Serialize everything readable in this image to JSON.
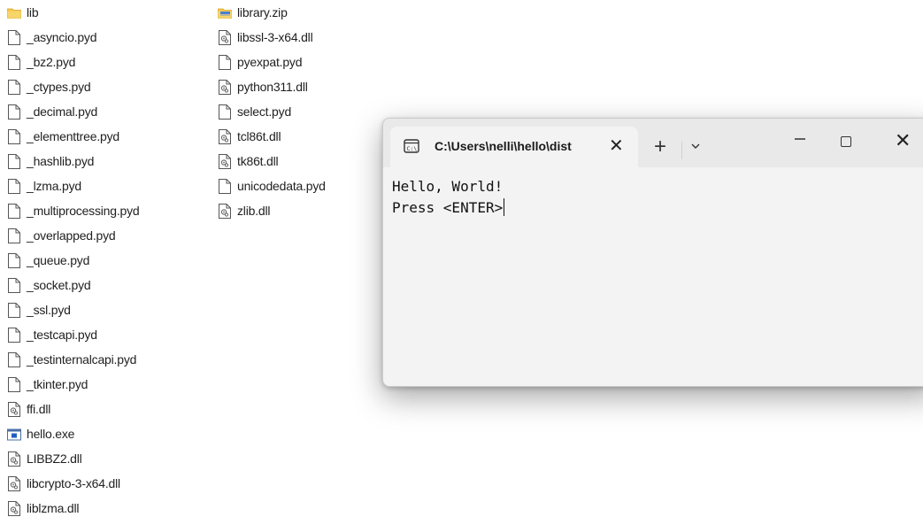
{
  "explorer": {
    "column1": [
      {
        "name": "lib",
        "icon": "folder-icon"
      },
      {
        "name": "_asyncio.pyd",
        "icon": "file-icon"
      },
      {
        "name": "_bz2.pyd",
        "icon": "file-icon"
      },
      {
        "name": "_ctypes.pyd",
        "icon": "file-icon"
      },
      {
        "name": "_decimal.pyd",
        "icon": "file-icon"
      },
      {
        "name": "_elementtree.pyd",
        "icon": "file-icon"
      },
      {
        "name": "_hashlib.pyd",
        "icon": "file-icon"
      },
      {
        "name": "_lzma.pyd",
        "icon": "file-icon"
      },
      {
        "name": "_multiprocessing.pyd",
        "icon": "file-icon"
      },
      {
        "name": "_overlapped.pyd",
        "icon": "file-icon"
      },
      {
        "name": "_queue.pyd",
        "icon": "file-icon"
      },
      {
        "name": "_socket.pyd",
        "icon": "file-icon"
      },
      {
        "name": "_ssl.pyd",
        "icon": "file-icon"
      },
      {
        "name": "_testcapi.pyd",
        "icon": "file-icon"
      },
      {
        "name": "_testinternalcapi.pyd",
        "icon": "file-icon"
      },
      {
        "name": "_tkinter.pyd",
        "icon": "file-icon"
      },
      {
        "name": "ffi.dll",
        "icon": "dll-icon"
      },
      {
        "name": "hello.exe",
        "icon": "exe-icon"
      },
      {
        "name": "LIBBZ2.dll",
        "icon": "dll-icon"
      },
      {
        "name": "libcrypto-3-x64.dll",
        "icon": "dll-icon"
      },
      {
        "name": "liblzma.dll",
        "icon": "dll-icon"
      }
    ],
    "column2": [
      {
        "name": "library.zip",
        "icon": "zip-folder-icon"
      },
      {
        "name": "libssl-3-x64.dll",
        "icon": "dll-icon"
      },
      {
        "name": "pyexpat.pyd",
        "icon": "file-icon"
      },
      {
        "name": "python311.dll",
        "icon": "dll-icon"
      },
      {
        "name": "select.pyd",
        "icon": "file-icon"
      },
      {
        "name": "tcl86t.dll",
        "icon": "dll-icon"
      },
      {
        "name": "tk86t.dll",
        "icon": "dll-icon"
      },
      {
        "name": "unicodedata.pyd",
        "icon": "file-icon"
      },
      {
        "name": "zlib.dll",
        "icon": "dll-icon"
      }
    ]
  },
  "terminal": {
    "tab_title": "C:\\Users\\nelli\\hello\\dist",
    "close_tab_glyph": "✕",
    "new_tab_glyph": "+",
    "close_window_glyph": "✕",
    "output_lines": [
      "Hello, World!",
      "Press <ENTER>"
    ]
  },
  "colors": {
    "folder": "#f4c54a",
    "terminal_bg": "#f3f3f3",
    "titlebar_bg": "#e9e9e9"
  }
}
